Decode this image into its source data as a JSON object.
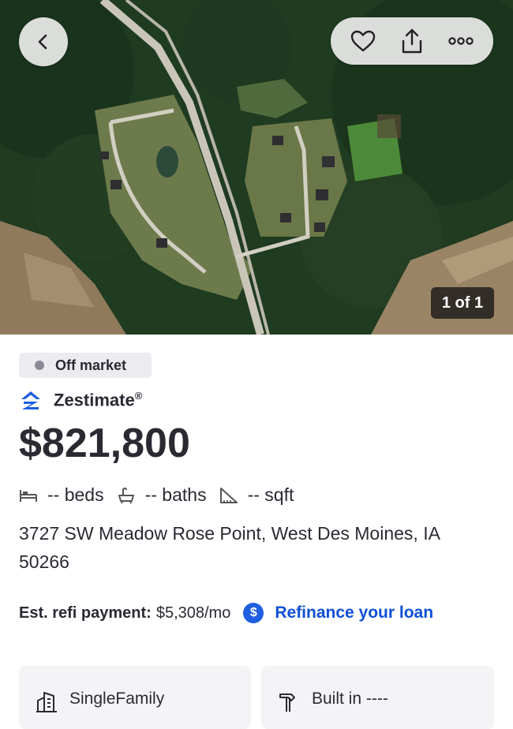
{
  "hero": {
    "image_desc_icon": "aerial-photo",
    "counter": "1 of 1"
  },
  "nav": {
    "back_icon": "chevron-left-icon",
    "actions": [
      "heart-icon",
      "share-icon",
      "more-icon"
    ]
  },
  "status": {
    "label": "Off market",
    "dot_color": "#8a8a94"
  },
  "zestimate": {
    "label": "Zestimate",
    "mark": "®",
    "value": "$821,800"
  },
  "facts": {
    "beds": "-- beds",
    "baths": "-- baths",
    "sqft": "-- sqft"
  },
  "address": "3727 SW Meadow Rose Point, West Des Moines, IA 50266",
  "refi": {
    "label": "Est. refi payment:",
    "value": "$5,308/mo",
    "link": "Refinance your loan",
    "link_color": "#0d4fd6"
  },
  "cards": [
    {
      "label": "SingleFamily",
      "icon": "building-icon"
    },
    {
      "label": "Built in ----",
      "icon": "hammer-icon"
    }
  ]
}
